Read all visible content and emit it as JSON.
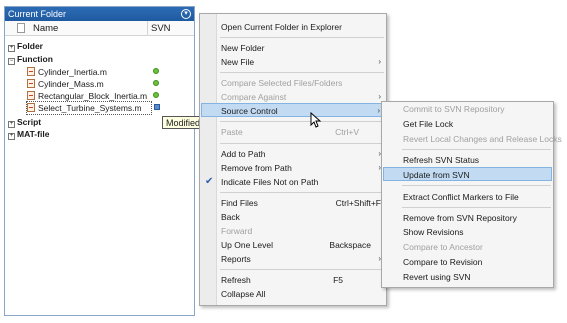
{
  "panel": {
    "title": "Current Folder",
    "col_name": "Name",
    "col_svn": "SVN",
    "groups": {
      "folder": "Folder",
      "function": "Function",
      "script": "Script",
      "matfile": "MAT-file"
    },
    "files": [
      {
        "name": "Cylinder_Inertia.m",
        "status": "green"
      },
      {
        "name": "Cylinder_Mass.m",
        "status": "green"
      },
      {
        "name": "Rectangular_Block_Inertia.m",
        "status": "green"
      },
      {
        "name": "Select_Turbine_Systems.m",
        "status": "blue"
      }
    ],
    "tooltip": "Modified"
  },
  "menu1": {
    "items": [
      {
        "label": "Open Current Folder in Explorer"
      },
      {
        "label": "New Folder"
      },
      {
        "label": "New File",
        "sub": true
      },
      {
        "label": "Compare Selected Files/Folders",
        "disabled": true
      },
      {
        "label": "Compare Against",
        "disabled": true,
        "sub": true
      },
      {
        "label": "Source Control",
        "highlight": true,
        "sub": true
      },
      {
        "label": "Paste",
        "shortcut": "Ctrl+V",
        "disabled": true
      },
      {
        "label": "Add to Path",
        "sub": true
      },
      {
        "label": "Remove from Path",
        "sub": true
      },
      {
        "label": "Indicate Files Not on Path",
        "checked": true
      },
      {
        "label": "Find Files",
        "shortcut": "Ctrl+Shift+F"
      },
      {
        "label": "Back"
      },
      {
        "label": "Forward",
        "disabled": true
      },
      {
        "label": "Up One Level",
        "shortcut": "Backspace"
      },
      {
        "label": "Reports",
        "sub": true
      },
      {
        "label": "Refresh",
        "shortcut": "F5"
      },
      {
        "label": "Collapse All"
      }
    ]
  },
  "menu2": {
    "items": [
      {
        "label": "Commit to SVN Repository",
        "disabled": true
      },
      {
        "label": "Get File Lock"
      },
      {
        "label": "Revert Local Changes and Release Locks",
        "disabled": true
      },
      {
        "label": "Refresh SVN Status"
      },
      {
        "label": "Update from SVN",
        "highlight": true
      },
      {
        "label": "Extract Conflict Markers to File"
      },
      {
        "label": "Remove from SVN Repository"
      },
      {
        "label": "Show Revisions"
      },
      {
        "label": "Compare to Ancestor",
        "disabled": true
      },
      {
        "label": "Compare to Revision"
      },
      {
        "label": "Revert using SVN"
      }
    ]
  },
  "colors": {
    "title_bar": "#1f5aa0",
    "status_green": "#6cc03c",
    "status_modified": "#5a8ad0",
    "highlight": "#c2dbf3",
    "check": "#2f63a8"
  }
}
